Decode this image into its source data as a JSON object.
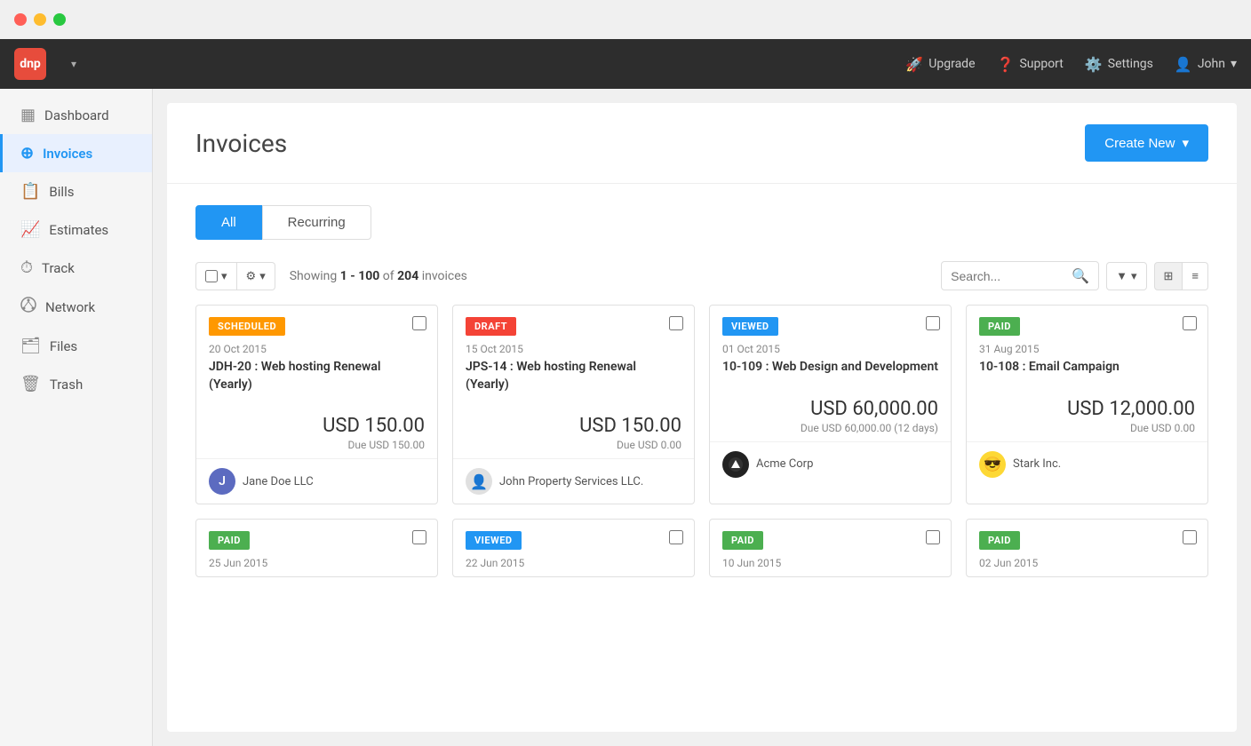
{
  "titlebar": {
    "buttons": [
      "close",
      "minimize",
      "maximize"
    ]
  },
  "topnav": {
    "logo": "dnp",
    "upgrade_label": "Upgrade",
    "support_label": "Support",
    "settings_label": "Settings",
    "user_label": "John"
  },
  "sidebar": {
    "items": [
      {
        "id": "dashboard",
        "label": "Dashboard",
        "icon": "⊞"
      },
      {
        "id": "invoices",
        "label": "Invoices",
        "icon": "+"
      },
      {
        "id": "bills",
        "label": "Bills",
        "icon": "📄"
      },
      {
        "id": "estimates",
        "label": "Estimates",
        "icon": "📊"
      },
      {
        "id": "track",
        "label": "Track",
        "icon": "⏱"
      },
      {
        "id": "network",
        "label": "Network",
        "icon": "⬡"
      },
      {
        "id": "files",
        "label": "Files",
        "icon": "🗂"
      },
      {
        "id": "trash",
        "label": "Trash",
        "icon": "🗑"
      }
    ],
    "active": "invoices"
  },
  "page": {
    "title": "Invoices",
    "create_new_label": "Create New"
  },
  "tabs": [
    {
      "id": "all",
      "label": "All",
      "active": true
    },
    {
      "id": "recurring",
      "label": "Recurring",
      "active": false
    }
  ],
  "toolbar": {
    "showing_text": "Showing",
    "range_start": "1",
    "range_end": "100",
    "of_text": "of",
    "total": "204",
    "invoices_text": "invoices",
    "search_placeholder": "Search..."
  },
  "invoices": [
    {
      "status": "SCHEDULED",
      "status_class": "scheduled",
      "date": "20 Oct 2015",
      "id_title": "JDH-20 : Web hosting Renewal (Yearly)",
      "amount": "USD 150.00",
      "due": "Due USD 150.00",
      "client_name": "Jane Doe LLC",
      "client_avatar_letter": "J",
      "client_avatar_color": "#5C6BC0"
    },
    {
      "status": "DRAFT",
      "status_class": "draft",
      "date": "15 Oct 2015",
      "id_title": "JPS-14 : Web hosting Renewal (Yearly)",
      "amount": "USD 150.00",
      "due": "Due USD 0.00",
      "client_name": "John Property Services LLC.",
      "client_avatar_letter": "👤",
      "client_avatar_color": "#bbb"
    },
    {
      "status": "VIEWED",
      "status_class": "viewed",
      "date": "01 Oct 2015",
      "id_title": "10-109 : Web Design and Development",
      "amount": "USD 60,000.00",
      "due": "Due USD 60,000.00 (12 days)",
      "client_name": "Acme Corp",
      "client_avatar_letter": "🔲",
      "client_avatar_color": "#333"
    },
    {
      "status": "PAID",
      "status_class": "paid",
      "date": "31 Aug 2015",
      "id_title": "10-108 : Email Campaign",
      "amount": "USD 12,000.00",
      "due": "Due USD 0.00",
      "client_name": "Stark Inc.",
      "client_avatar_letter": "😎",
      "client_avatar_color": "#FDD835"
    },
    {
      "status": "PAID",
      "status_class": "paid",
      "date": "25 Jun 2015",
      "id_title": "",
      "amount": "",
      "due": "",
      "client_name": "",
      "client_avatar_letter": "",
      "client_avatar_color": "#4CAF50"
    },
    {
      "status": "VIEWED",
      "status_class": "viewed",
      "date": "22 Jun 2015",
      "id_title": "",
      "amount": "",
      "due": "",
      "client_name": "",
      "client_avatar_letter": "",
      "client_avatar_color": "#2196F3"
    },
    {
      "status": "PAID",
      "status_class": "paid",
      "date": "10 Jun 2015",
      "id_title": "",
      "amount": "",
      "due": "",
      "client_name": "",
      "client_avatar_letter": "",
      "client_avatar_color": "#4CAF50"
    },
    {
      "status": "PAID",
      "status_class": "paid",
      "date": "02 Jun 2015",
      "id_title": "",
      "amount": "",
      "due": "",
      "client_name": "",
      "client_avatar_letter": "",
      "client_avatar_color": "#4CAF50"
    }
  ]
}
